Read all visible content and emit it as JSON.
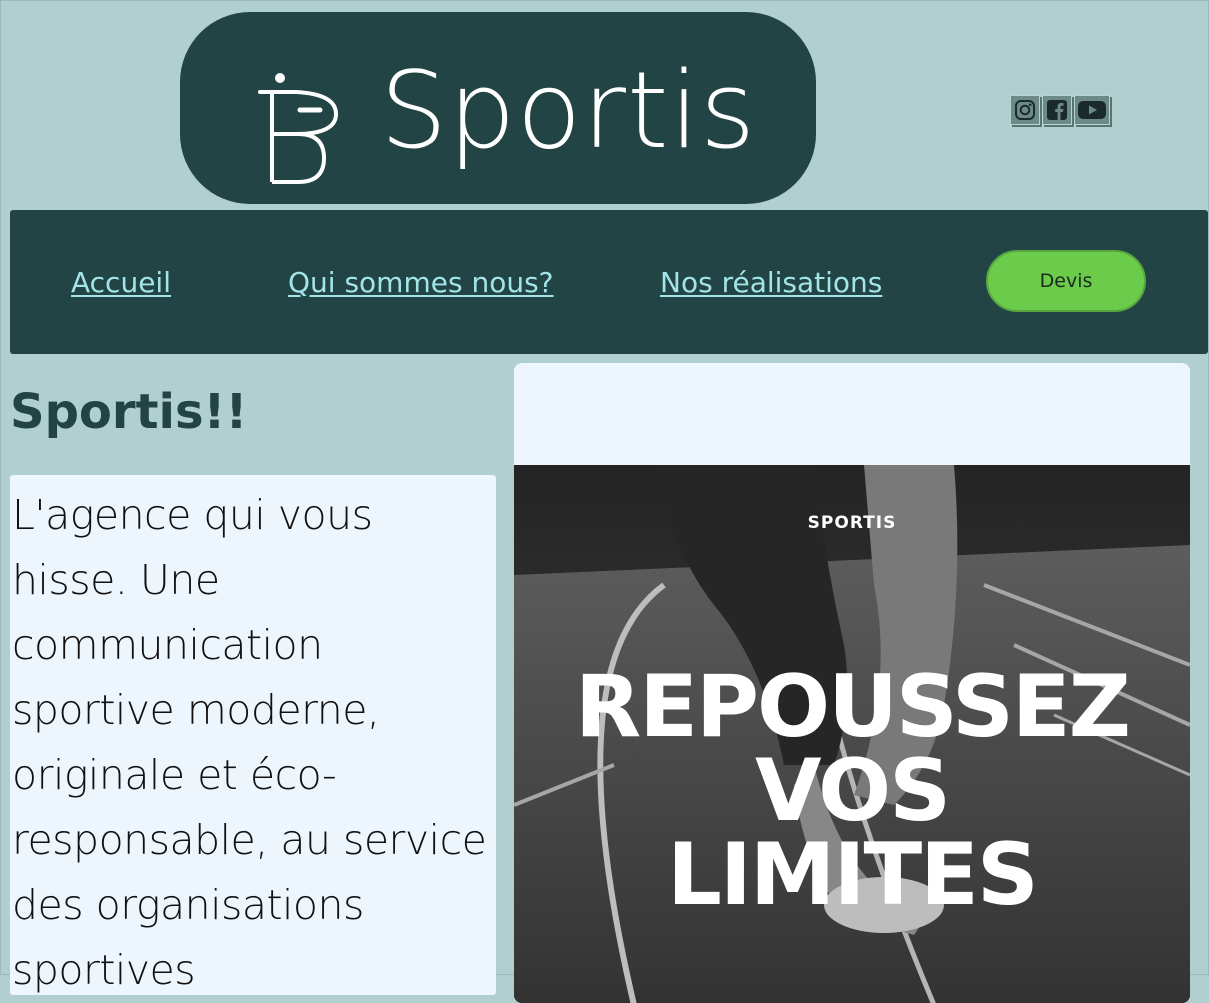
{
  "header": {
    "logo_text": "Sportis",
    "social": [
      {
        "icon": "instagram-icon"
      },
      {
        "icon": "facebook-icon"
      },
      {
        "icon": "youtube-icon"
      }
    ]
  },
  "nav": {
    "links": [
      "Accueil",
      "Qui sommes nous?",
      "Nos réalisations"
    ],
    "cta": "Devis"
  },
  "main": {
    "title": "Sportis!!",
    "intro": "L'agence qui vous hisse. Une communication sportive moderne, originale et éco-responsable, au service des organisations sportives"
  },
  "hero": {
    "brand": "SPORTIS",
    "title_lines": [
      "REPOUSSEZ",
      "VOS",
      "LIMITES"
    ]
  },
  "colors": {
    "page_bg": "#b0cfce",
    "dark_teal": "#234444",
    "nav_link": "#a3e4e8",
    "cta_green": "#6bcb4b",
    "panel_bg": "#eef6fd"
  }
}
